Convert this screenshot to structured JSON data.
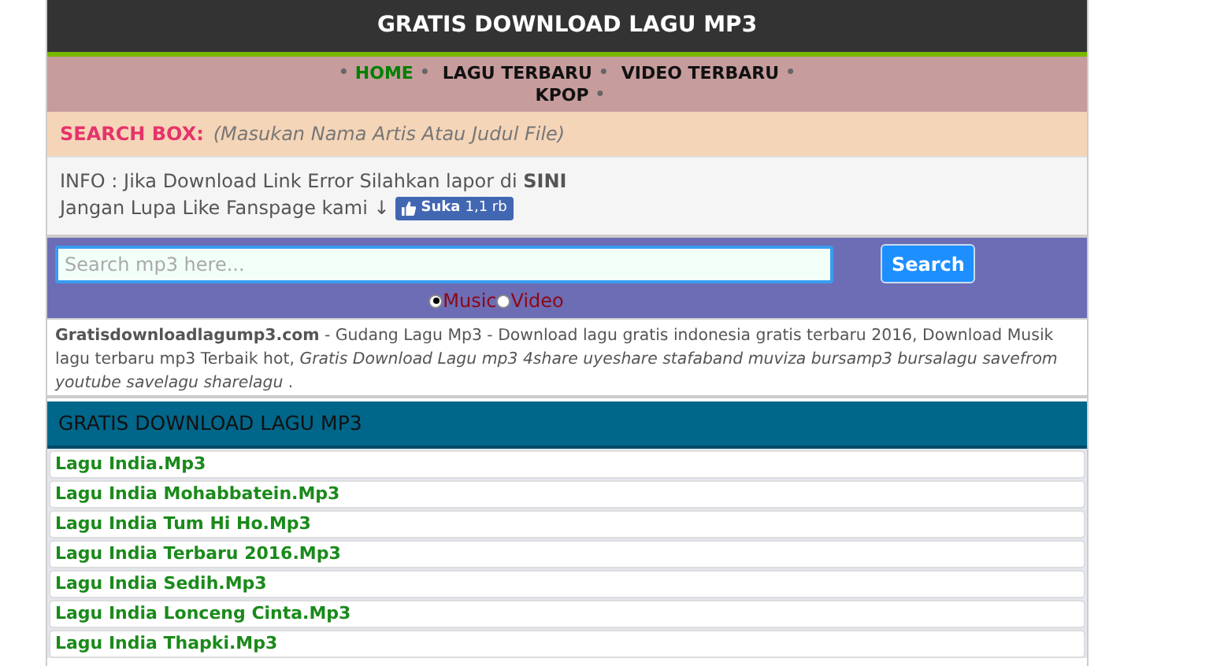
{
  "header": {
    "title": "GRATIS DOWNLOAD LAGU MP3"
  },
  "nav": {
    "separator": "•",
    "items": [
      {
        "label": "HOME",
        "selected": true
      },
      {
        "label": "LAGU TERBARU",
        "selected": false
      },
      {
        "label": "VIDEO TERBARU",
        "selected": false
      },
      {
        "label": "KPOP",
        "selected": false
      }
    ]
  },
  "search_box_label": {
    "label": "SEARCH BOX:",
    "hint": "(Masukan Nama Artis Atau Judul File)"
  },
  "info": {
    "line_1": "INFO : Jika Download Link Error Silahkan lapor di **SINI**",
    "line_2": "Jangan Lupa Like Fanspage kami ↓",
    "like_button": {
      "label": "Suka",
      "count": "1,1 rb"
    }
  },
  "search": {
    "placeholder": "Search mp3 here...",
    "button": "Search",
    "options": [
      {
        "label": "Music",
        "selected": true
      },
      {
        "label": "Video",
        "selected": false
      }
    ]
  },
  "description": "**Gratisdownloadlagump3.com** - Gudang Lagu Mp3 - Download lagu gratis indonesia gratis terbaru 2016, Download Musik lagu terbaru mp3 Terbaik hot, *Gratis Download Lagu mp3 4share uyeshare stafaband muviza bursamp3 bursalagu savefrom youtube savelagu sharelagu* .",
  "section": {
    "title": "GRATIS DOWNLOAD LAGU MP3",
    "items": [
      "Lagu India.Mp3",
      "Lagu India Mohabbatein.Mp3",
      "Lagu India Tum Hi Ho.Mp3",
      "Lagu India Terbaru 2016.Mp3",
      "Lagu India Sedih.Mp3",
      "Lagu India Lonceng Cinta.Mp3",
      "Lagu India Thapki.Mp3"
    ]
  }
}
